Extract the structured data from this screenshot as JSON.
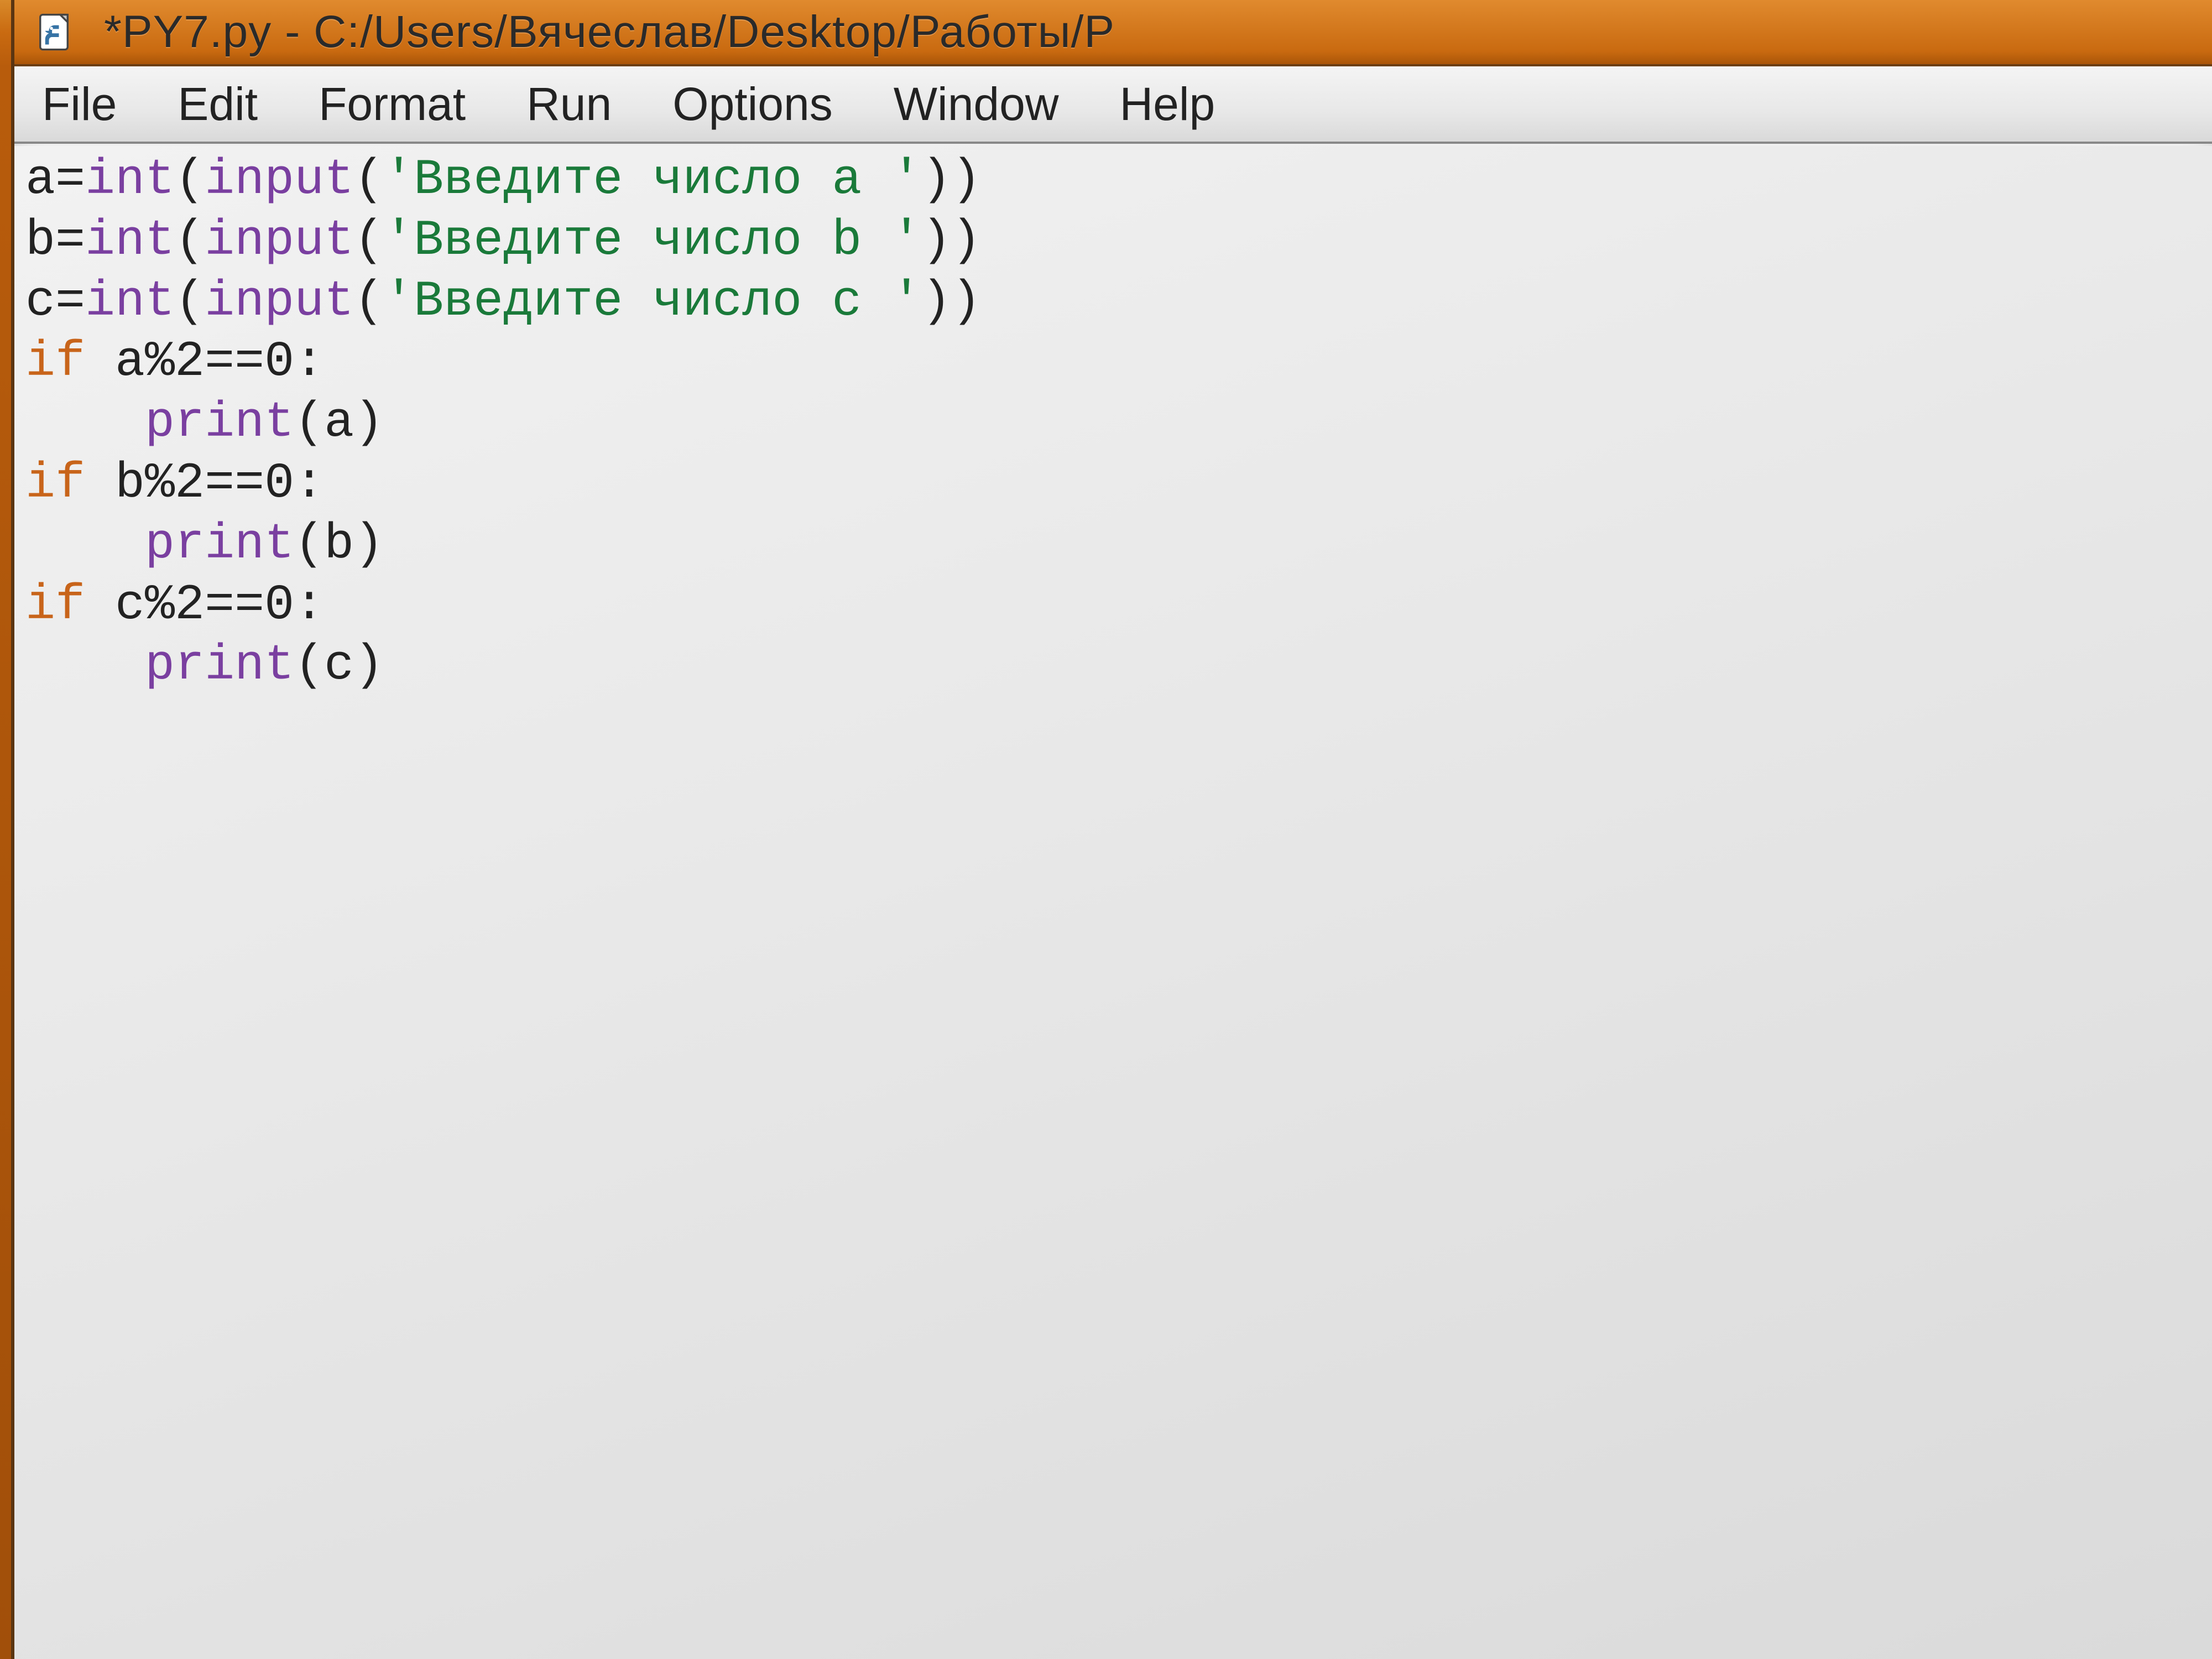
{
  "titlebar": {
    "title": "*PY7.py - C:/Users/Вячеслав/Desktop/Работы/P"
  },
  "menubar": {
    "items": [
      "File",
      "Edit",
      "Format",
      "Run",
      "Options",
      "Window",
      "Help"
    ]
  },
  "code": {
    "lines": [
      [
        {
          "t": "a=",
          "c": "plain"
        },
        {
          "t": "int",
          "c": "builtin"
        },
        {
          "t": "(",
          "c": "plain"
        },
        {
          "t": "input",
          "c": "builtin"
        },
        {
          "t": "(",
          "c": "plain"
        },
        {
          "t": "'Введите число a '",
          "c": "string"
        },
        {
          "t": "))",
          "c": "plain"
        }
      ],
      [
        {
          "t": "b=",
          "c": "plain"
        },
        {
          "t": "int",
          "c": "builtin"
        },
        {
          "t": "(",
          "c": "plain"
        },
        {
          "t": "input",
          "c": "builtin"
        },
        {
          "t": "(",
          "c": "plain"
        },
        {
          "t": "'Введите число b '",
          "c": "string"
        },
        {
          "t": "))",
          "c": "plain"
        }
      ],
      [
        {
          "t": "c=",
          "c": "plain"
        },
        {
          "t": "int",
          "c": "builtin"
        },
        {
          "t": "(",
          "c": "plain"
        },
        {
          "t": "input",
          "c": "builtin"
        },
        {
          "t": "(",
          "c": "plain"
        },
        {
          "t": "'Введите число c '",
          "c": "string"
        },
        {
          "t": "))",
          "c": "plain"
        }
      ],
      [
        {
          "t": "if",
          "c": "keyword"
        },
        {
          "t": " a%2==0:",
          "c": "plain"
        }
      ],
      [
        {
          "t": "    ",
          "c": "plain"
        },
        {
          "t": "print",
          "c": "builtin"
        },
        {
          "t": "(a)",
          "c": "plain"
        }
      ],
      [
        {
          "t": "if",
          "c": "keyword"
        },
        {
          "t": " b%2==0:",
          "c": "plain"
        }
      ],
      [
        {
          "t": "    ",
          "c": "plain"
        },
        {
          "t": "print",
          "c": "builtin"
        },
        {
          "t": "(b)",
          "c": "plain"
        }
      ],
      [
        {
          "t": "if",
          "c": "keyword"
        },
        {
          "t": " c%2==0:",
          "c": "plain"
        }
      ],
      [
        {
          "t": "    ",
          "c": "plain"
        },
        {
          "t": "print",
          "c": "builtin"
        },
        {
          "t": "(c)",
          "c": "plain"
        }
      ]
    ]
  }
}
